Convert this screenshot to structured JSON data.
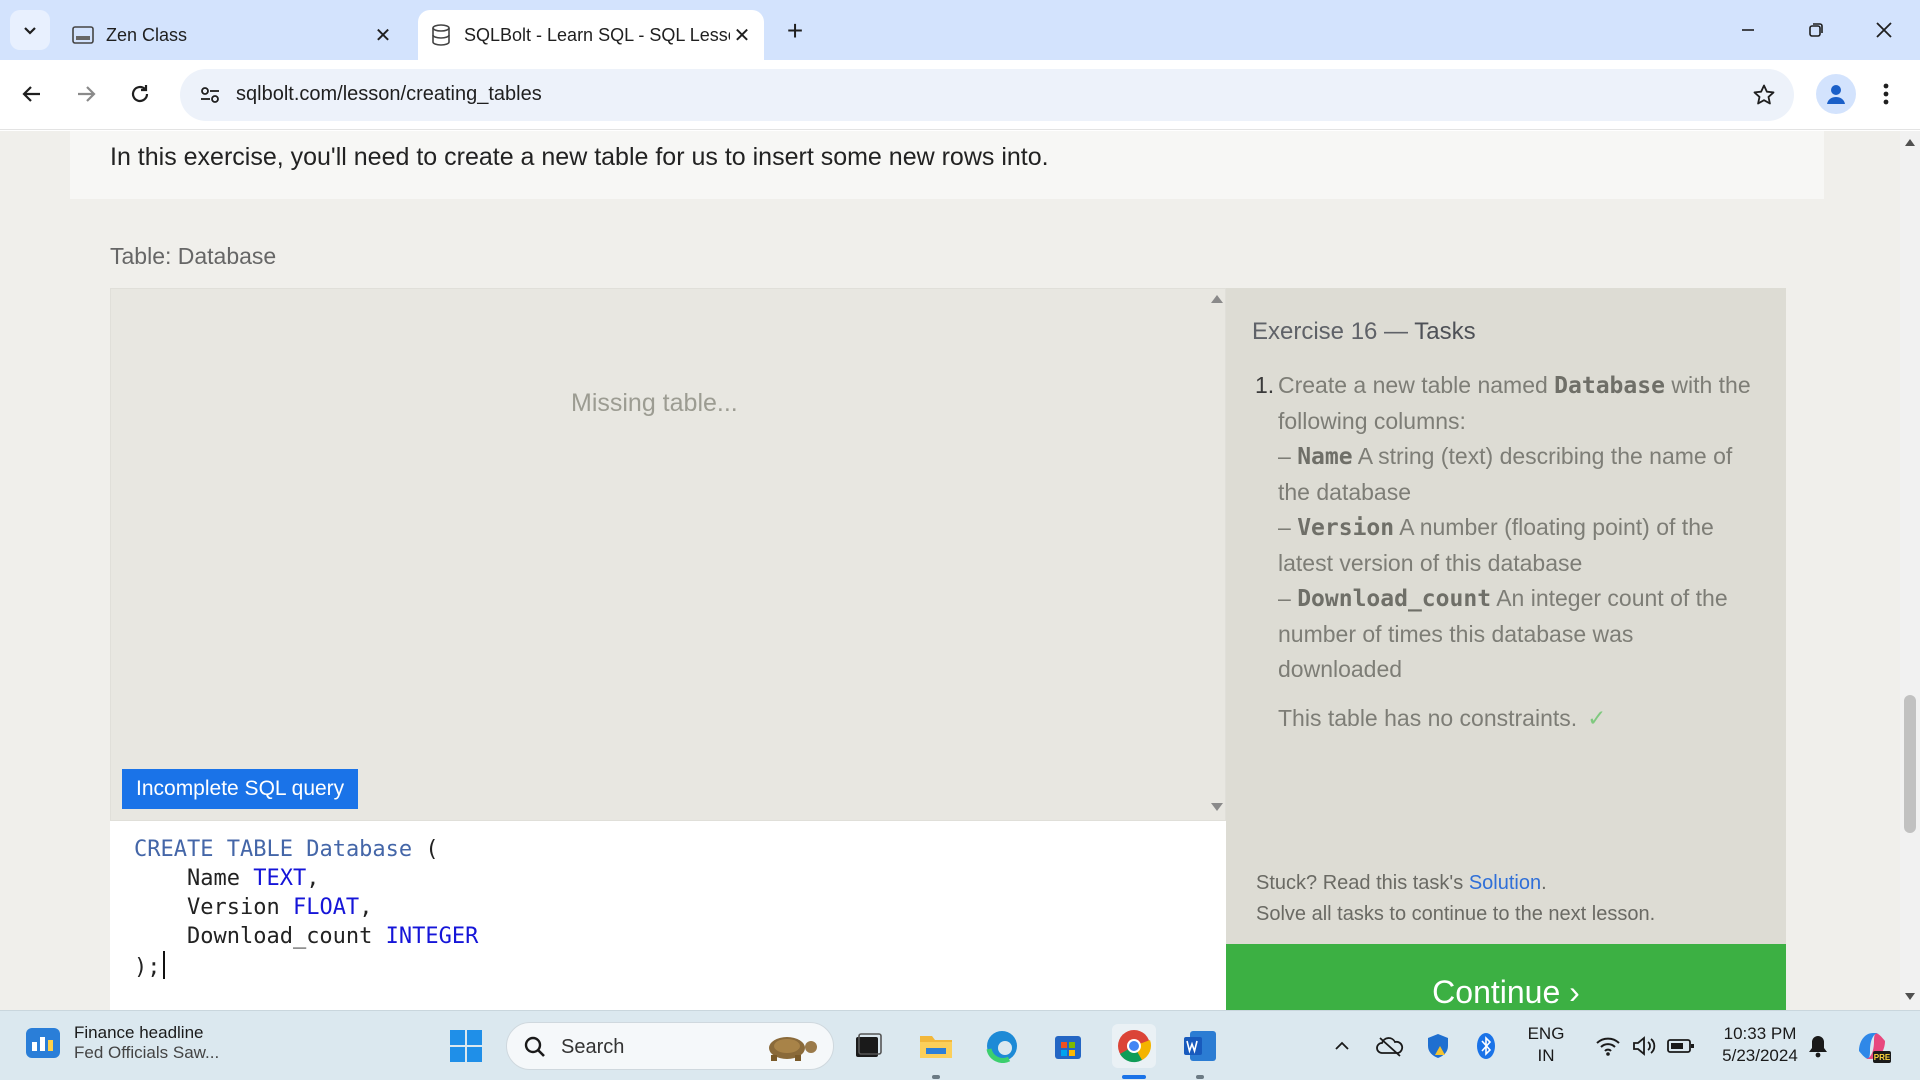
{
  "browser": {
    "tabs": [
      {
        "title": "Zen Class",
        "active": false
      },
      {
        "title": "SQLBolt - Learn SQL - SQL Lesso",
        "active": true
      }
    ],
    "url": "sqlbolt.com/lesson/creating_tables"
  },
  "page": {
    "intro": "In this exercise, you'll need to create a new table for us to insert some new rows into.",
    "table_label": "Table: Database",
    "missing_table": "Missing table...",
    "status_badge": "Incomplete SQL query",
    "editor": {
      "line1_kw": "CREATE TABLE",
      "line1_name": "Database",
      "line1_paren": "(",
      "line2_col": "Name",
      "line2_type": "TEXT",
      "line3_col": "Version",
      "line3_type": "FLOAT",
      "line4_col": "Download_count",
      "line4_type": "INTEGER",
      "line5": ");"
    },
    "tasks": {
      "title_prefix": "Exercise 16 —",
      "title_suffix": "Tasks",
      "number": "1.",
      "intro_a": "Create a new table named",
      "intro_code": "Database",
      "intro_b": "with the following columns:",
      "columns": [
        {
          "dash": "–",
          "name": "Name",
          "desc": "A string (text) describing the name of the database"
        },
        {
          "dash": "–",
          "name": "Version",
          "desc": "A number (floating point) of the latest version of this database"
        },
        {
          "dash": "–",
          "name": "Download_count",
          "desc": "An integer count of the number of times this database was downloaded"
        }
      ],
      "no_constraints": "This table has no constraints.",
      "check": "✓"
    },
    "stuck_prefix": "Stuck? Read this task's",
    "solution_link": "Solution",
    "stuck_suffix": ".",
    "solve_all": "Solve all tasks to continue to the next lesson.",
    "continue_label": "Continue ›"
  },
  "taskbar": {
    "news_title": "Finance headline",
    "news_sub": "Fed Officials Saw...",
    "search_placeholder": "Search",
    "lang_1": "ENG",
    "lang_2": "IN",
    "time": "10:33 PM",
    "date": "5/23/2024"
  },
  "colors": {
    "accent_blue": "#1a73e8",
    "continue_green": "#3cb043",
    "tabstrip": "#d3e3fd"
  }
}
